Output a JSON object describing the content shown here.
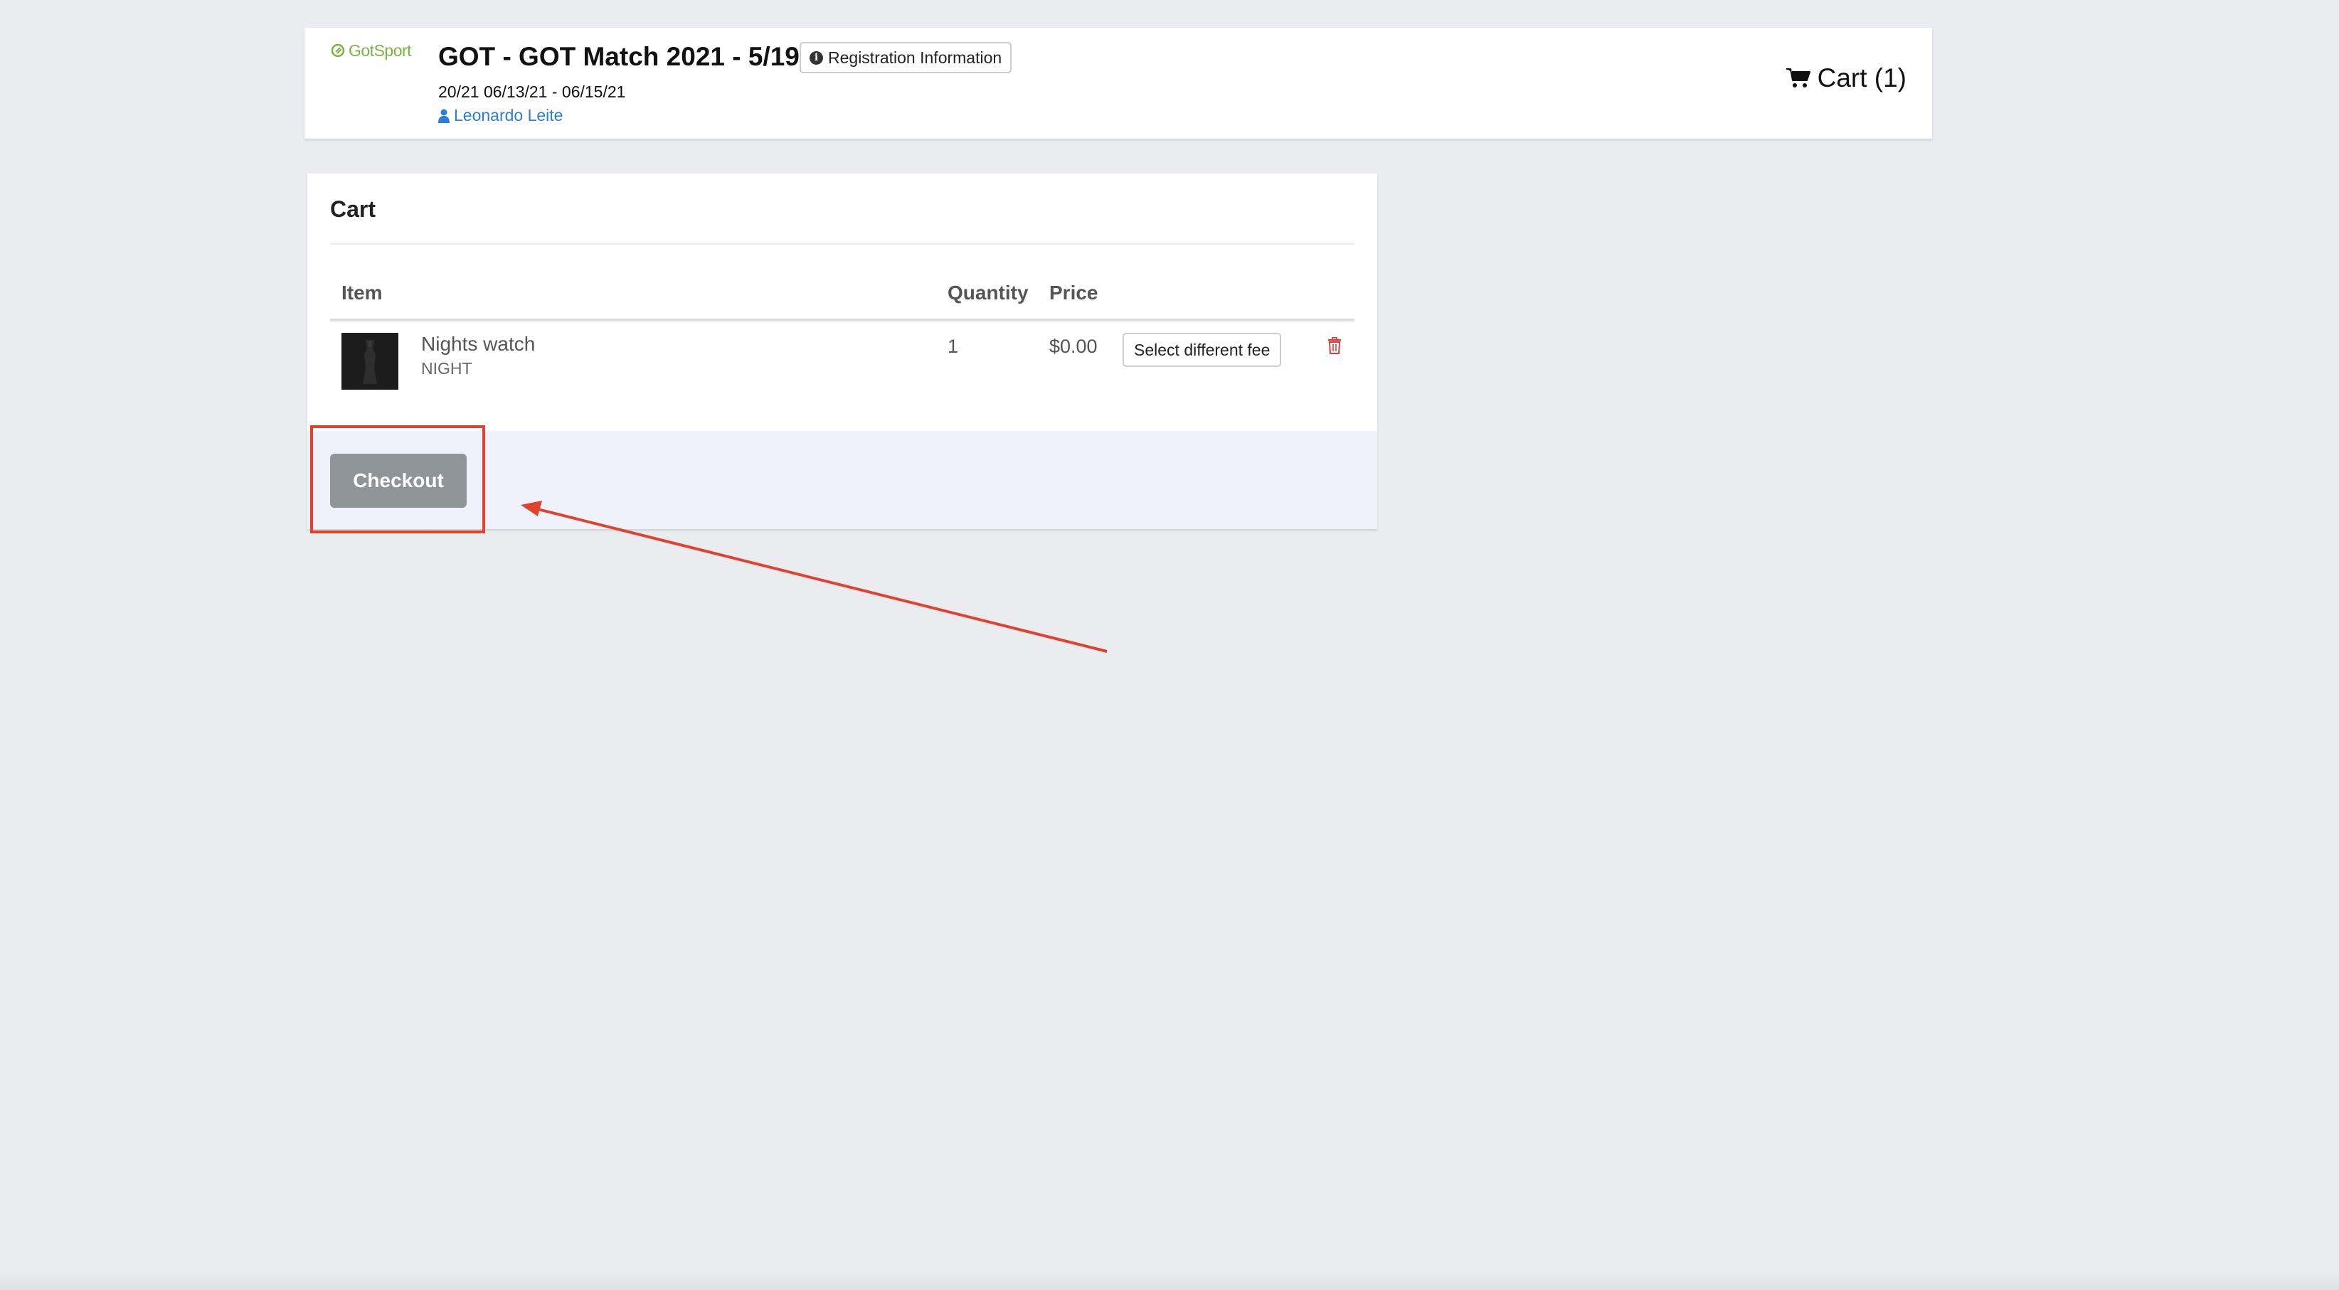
{
  "header": {
    "logo_text": "GotSport",
    "event_title": "GOT - GOT Match 2021 - 5/19",
    "registration_info_label": "Registration Information",
    "event_dates": "20/21 06/13/21 - 06/15/21",
    "user_name": "Leonardo Leite",
    "cart_label": "Cart (1)"
  },
  "cart": {
    "title": "Cart",
    "columns": {
      "item": "Item",
      "quantity": "Quantity",
      "price": "Price"
    },
    "items": [
      {
        "name": "Nights watch",
        "code": "NIGHT",
        "quantity": "1",
        "price": "$0.00",
        "select_fee_label": "Select different fee",
        "icon": "trash-icon"
      }
    ],
    "checkout_label": "Checkout"
  },
  "colors": {
    "background": "#ebecf0",
    "brand_green": "#7bb342",
    "link_blue": "#2a7ed8",
    "delete_red": "#e03b3b",
    "checkout_gray": "#8e9599",
    "annotation_red": "#e0432d"
  }
}
